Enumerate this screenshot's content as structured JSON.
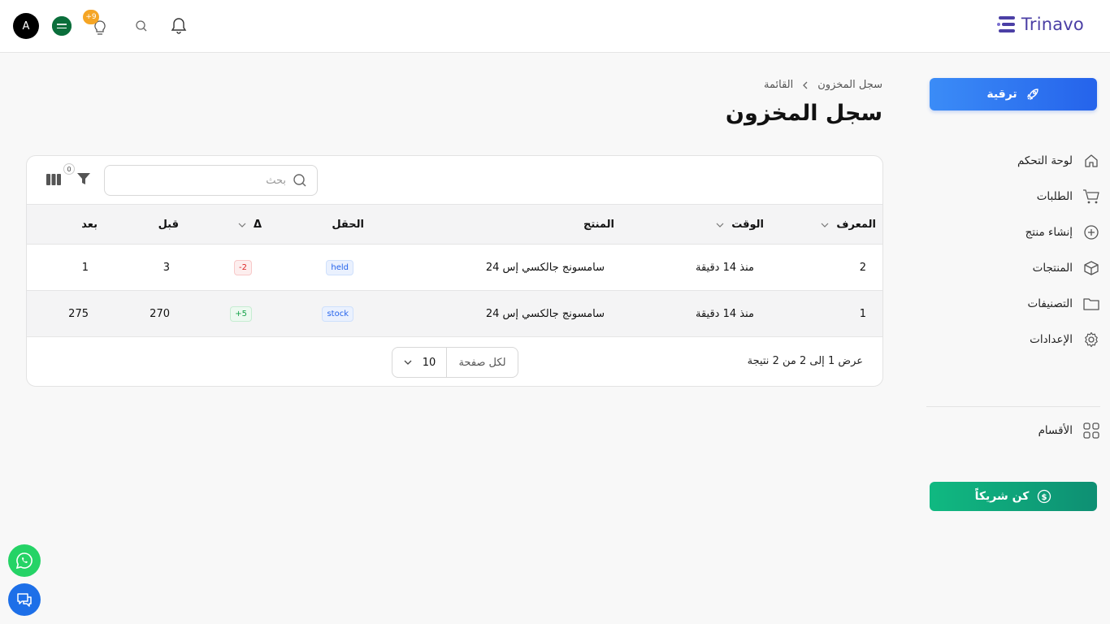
{
  "header": {
    "logo_text": "Trinavo",
    "avatar_letter": "A",
    "notifications_count": "+9"
  },
  "sidebar": {
    "upgrade_label": "ترقية",
    "items": [
      {
        "label": "لوحة التحكم",
        "icon": "home-icon"
      },
      {
        "label": "الطلبات",
        "icon": "cart-icon"
      },
      {
        "label": "إنشاء منتج",
        "icon": "plus-circle-icon"
      },
      {
        "label": "المنتجات",
        "icon": "box-icon"
      },
      {
        "label": "التصنيفات",
        "icon": "folder-icon"
      },
      {
        "label": "الإعدادات",
        "icon": "gear-icon"
      }
    ],
    "sections_label": "الأقسام",
    "partner_label": "كن شريكاً"
  },
  "page": {
    "breadcrumb": [
      "سجل المخزون",
      "القائمة"
    ],
    "title": "سجل المخزون"
  },
  "table": {
    "search_placeholder": "بحث",
    "filter_count": "0",
    "columns": {
      "id": "المعرف",
      "time": "الوقت",
      "product": "المنتج",
      "field": "الحقل",
      "delta": "Δ",
      "before": "قبل",
      "after": "بعد"
    },
    "rows": [
      {
        "id": "2",
        "time": "منذ 14 دقيقة",
        "product": "سامسونج جالكسي إس 24",
        "field": "held",
        "delta": "-2",
        "before": "3",
        "after": "1"
      },
      {
        "id": "1",
        "time": "منذ 14 دقيقة",
        "product": "سامسونج جالكسي إس 24",
        "field": "stock",
        "delta": "+5",
        "before": "270",
        "after": "275"
      }
    ],
    "footer_summary": "عرض 1 إلى 2 من 2 نتيجة",
    "per_page_label": "لكل صفحة",
    "per_page_value": "10"
  },
  "colors": {
    "brand": "#4b3fa5",
    "upgrade": "#2563eb",
    "partner": "#10b981"
  }
}
